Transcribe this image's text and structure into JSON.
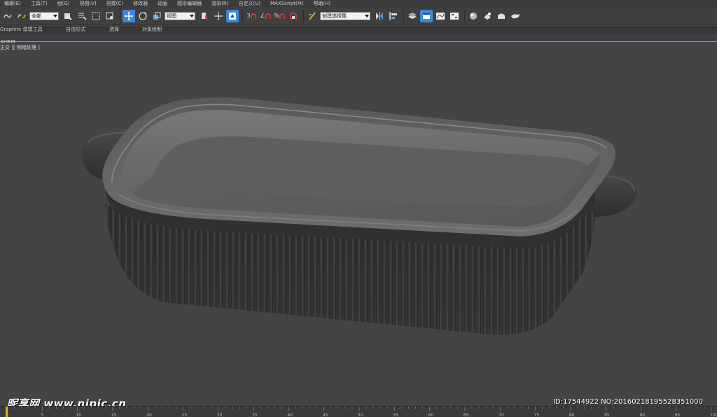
{
  "menubar": {
    "items": [
      "编辑(E)",
      "工具(T)",
      "组(G)",
      "视图(V)",
      "创建(C)",
      "修改器",
      "动画",
      "图形编辑器",
      "渲染(R)",
      "自定义(U)",
      "MAXScript(M)",
      "帮助(H)"
    ]
  },
  "toolbar": {
    "selection_filter": "全部",
    "reference_coord": "视图",
    "snap_toggle_label": "3",
    "angle_snap_label": "∠",
    "percent_snap_label": "%",
    "named_selection_placeholder": "创建选择集"
  },
  "ribbon": {
    "tabs": [
      "Graphite 建模工具",
      "自由形式",
      "选择",
      "对象绘制"
    ],
    "panel_label": "形建模"
  },
  "viewport": {
    "label": "正交 ][ 明暗处理 ]"
  },
  "watermark": {
    "left_text": "昵享网 www.nipic.cn",
    "right_text": "ID:17544922 NO:20160218195528351000"
  },
  "timeline": {
    "ticks": [
      "0",
      "5",
      "10",
      "15",
      "20",
      "25",
      "30",
      "35",
      "40",
      "45",
      "50",
      "55",
      "60",
      "65",
      "70",
      "75",
      "80",
      "85",
      "90",
      "95",
      "100"
    ]
  },
  "colors": {
    "accent": "#3e88d8",
    "viewport_bg": "#444444",
    "ribbon_border": "#c8a100"
  }
}
